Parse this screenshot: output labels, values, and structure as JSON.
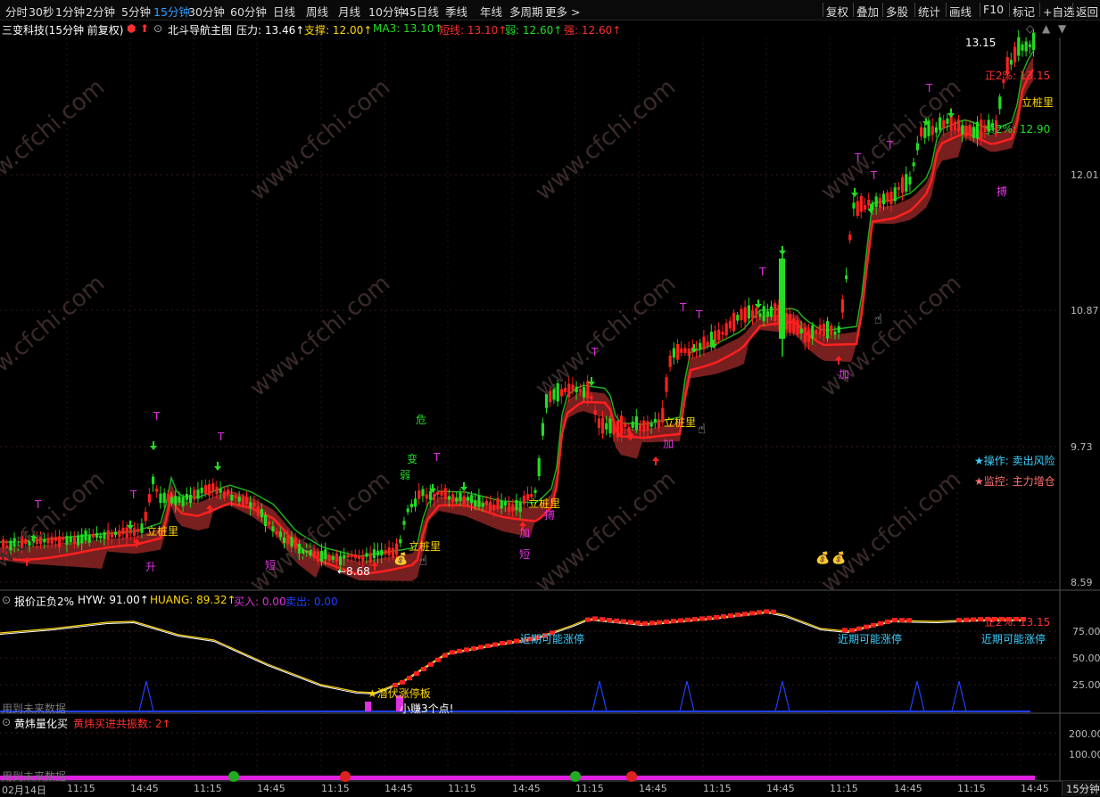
{
  "periods": [
    "分时",
    "30秒",
    "1分钟",
    "2分钟",
    "5分钟",
    "15分钟",
    "30分钟",
    "60分钟",
    "日线",
    "周线",
    "月线",
    "10分钟",
    "45日线",
    "季线",
    "年线",
    "多周期",
    "更多 >"
  ],
  "active_period_index": 5,
  "right_tools": [
    "复权",
    "叠加",
    "多股",
    "统计",
    "画线",
    "F10",
    "标记",
    "+自选",
    "返回"
  ],
  "info": {
    "stock_title": "三变科技(15分钟 前复权)",
    "indicator": "北斗导航主图",
    "pressure": "压力: 13.46↑",
    "support": "支撑: 12.00↑",
    "ma3": "MA3: 13.10↑",
    "short": "短线: 13.10↑",
    "weak": "弱: 12.60↑",
    "strong": "强: 12.60↑"
  },
  "price_axis": [
    "12.01",
    "10.87",
    "9.73",
    "8.59"
  ],
  "main_labels": {
    "high": "13.15",
    "low": "←8.68",
    "zheng": "正2%: 13.15",
    "fu": "负2%: 12.90",
    "op_label": "★操作: 卖出风险",
    "mon_label": "★监控: 主力增仓"
  },
  "marks": {
    "lizhuang": "立桩里",
    "sheng": "升",
    "duan": "短",
    "jia": "加",
    "bo": "搏",
    "wei": "危",
    "bian": "变",
    "ruo": "弱",
    "t": "T"
  },
  "mid_panel": {
    "title": "报价正负2%",
    "hyw": "HYW: 91.00↑",
    "huang": "HUANG: 89.32↑",
    "buy": "买入: 0.00",
    "sell": "卖出: 0.00",
    "axis": [
      "75.00",
      "50.00",
      "25.00"
    ],
    "near_limit": "近期可能涨停",
    "qianfu": "★潜伏涨停板",
    "zhuan": "小赚3个点!",
    "zheng2": "正2%: 13.15",
    "future": "用到未来数据"
  },
  "low_panel": {
    "title": "黄炜量化买",
    "count": "黄炜买进共振数: 2↑",
    "axis": [
      "200.00",
      "100.00"
    ],
    "future": "用到未来数据"
  },
  "time_axis": [
    "02月14日",
    "11:15",
    "14:45",
    "11:15",
    "14:45",
    "11:15",
    "14:45",
    "11:15",
    "14:45",
    "11:15",
    "14:45",
    "11:15",
    "14:45",
    "11:15",
    "14:45",
    "11:15",
    "14:45"
  ],
  "period_corner": "15分钟",
  "watermark": "www.cfchi.com",
  "colors": {
    "up": "#ff2020",
    "down": "#22dd22",
    "band": "#a02a2a",
    "accent": "#2f9bff"
  }
}
